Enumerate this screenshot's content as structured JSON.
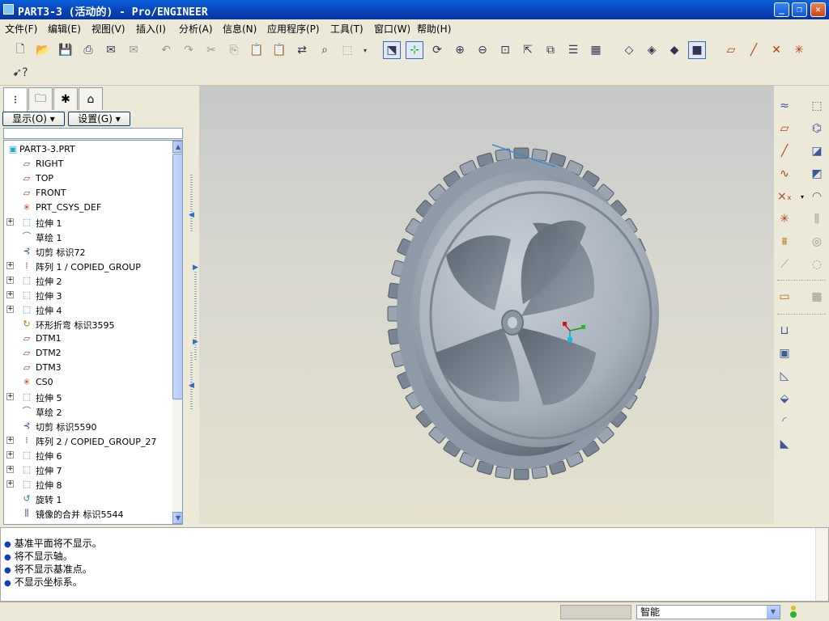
{
  "window": {
    "title": "PART3-3 (活动的) - Pro/ENGINEER",
    "min": "_",
    "max": "❐",
    "close": "✕"
  },
  "menu": [
    {
      "label": "文件(F)",
      "name": "menu-file"
    },
    {
      "label": "编辑(E)",
      "name": "menu-edit"
    },
    {
      "label": "视图(V)",
      "name": "menu-view"
    },
    {
      "label": "插入(I)",
      "name": "menu-insert"
    },
    {
      "label": "分析(A)",
      "name": "menu-analysis"
    },
    {
      "label": "信息(N)",
      "name": "menu-info"
    },
    {
      "label": "应用程序(P)",
      "name": "menu-applications"
    },
    {
      "label": "工具(T)",
      "name": "menu-tools"
    },
    {
      "label": "窗口(W)",
      "name": "menu-window"
    },
    {
      "label": "帮助(H)",
      "name": "menu-help"
    }
  ],
  "panel": {
    "show_label": "显示(O) ▾",
    "settings_label": "设置(G) ▾"
  },
  "tree": [
    {
      "label": "PART3-3.PRT",
      "icon": "part-icon",
      "glyph": "▣",
      "color": "#2aa6c8",
      "expand": ""
    },
    {
      "label": "RIGHT",
      "icon": "datum-plane-icon",
      "glyph": "▱",
      "color": "#b04010",
      "expand": ""
    },
    {
      "label": "TOP",
      "icon": "datum-plane-icon",
      "glyph": "▱",
      "color": "#b04010",
      "expand": ""
    },
    {
      "label": "FRONT",
      "icon": "datum-plane-icon",
      "glyph": "▱",
      "color": "#b04010",
      "expand": ""
    },
    {
      "label": "PRT_CSYS_DEF",
      "icon": "coordinate-system-icon",
      "glyph": "✳",
      "color": "#c04010",
      "expand": ""
    },
    {
      "label": "拉伸 1",
      "icon": "extrude-icon",
      "glyph": "⬚",
      "color": "#2a7ab0",
      "expand": "+"
    },
    {
      "label": "草绘 1",
      "icon": "sketch-icon",
      "glyph": "⌒",
      "color": "#2a7ab0",
      "expand": ""
    },
    {
      "label": "切剪 标识72",
      "icon": "cut-icon",
      "glyph": "⊰",
      "color": "#3a5a9a",
      "expand": ""
    },
    {
      "label": "阵列 1 / COPIED_GROUP",
      "icon": "pattern-icon",
      "glyph": "⁞",
      "color": "#a03080",
      "expand": "+"
    },
    {
      "label": "拉伸 2",
      "icon": "extrude-icon",
      "glyph": "⬚",
      "color": "#2a7ab0",
      "expand": "+"
    },
    {
      "label": "拉伸 3",
      "icon": "extrude-icon",
      "glyph": "⬚",
      "color": "#2a7ab0",
      "expand": "+"
    },
    {
      "label": "拉伸 4",
      "icon": "extrude-icon",
      "glyph": "⬚",
      "color": "#2a7ab0",
      "expand": "+"
    },
    {
      "label": "环形折弯 标识3595",
      "icon": "toroidal-bend-icon",
      "glyph": "↻",
      "color": "#c07010",
      "expand": ""
    },
    {
      "label": "DTM1",
      "icon": "datum-plane-icon",
      "glyph": "▱",
      "color": "#b04010",
      "expand": ""
    },
    {
      "label": "DTM2",
      "icon": "datum-plane-icon",
      "glyph": "▱",
      "color": "#b04010",
      "expand": ""
    },
    {
      "label": "DTM3",
      "icon": "datum-plane-icon",
      "glyph": "▱",
      "color": "#b04010",
      "expand": ""
    },
    {
      "label": "CS0",
      "icon": "coordinate-system-icon",
      "glyph": "✳",
      "color": "#c04010",
      "expand": ""
    },
    {
      "label": "拉伸 5",
      "icon": "extrude-icon",
      "glyph": "⬚",
      "color": "#2a7ab0",
      "expand": "+"
    },
    {
      "label": "草绘 2",
      "icon": "sketch-icon",
      "glyph": "⌒",
      "color": "#2a7ab0",
      "expand": ""
    },
    {
      "label": "切剪 标识5590",
      "icon": "cut-icon",
      "glyph": "⊰",
      "color": "#3a5a9a",
      "expand": ""
    },
    {
      "label": "阵列 2 / COPIED_GROUP_27",
      "icon": "pattern-icon",
      "glyph": "⁞",
      "color": "#a03080",
      "expand": "+"
    },
    {
      "label": "拉伸 6",
      "icon": "extrude-icon",
      "glyph": "⬚",
      "color": "#2a7ab0",
      "expand": "+"
    },
    {
      "label": "拉伸 7",
      "icon": "extrude-icon",
      "glyph": "⬚",
      "color": "#2a7ab0",
      "expand": "+"
    },
    {
      "label": "拉伸 8",
      "icon": "extrude-icon",
      "glyph": "⬚",
      "color": "#2a7ab0",
      "expand": "+"
    },
    {
      "label": "旋转 1",
      "icon": "revolve-icon",
      "glyph": "↺",
      "color": "#2a7ab0",
      "expand": ""
    },
    {
      "label": "镜像的合并 标识5544",
      "icon": "mirror-merge-icon",
      "glyph": "⫼",
      "color": "#3a5a9a",
      "expand": ""
    }
  ],
  "messages": [
    "基准平面将不显示。",
    "将不显示轴。",
    "将不显示基准点。",
    "不显示坐标系。"
  ],
  "status": {
    "filter": "智能"
  }
}
